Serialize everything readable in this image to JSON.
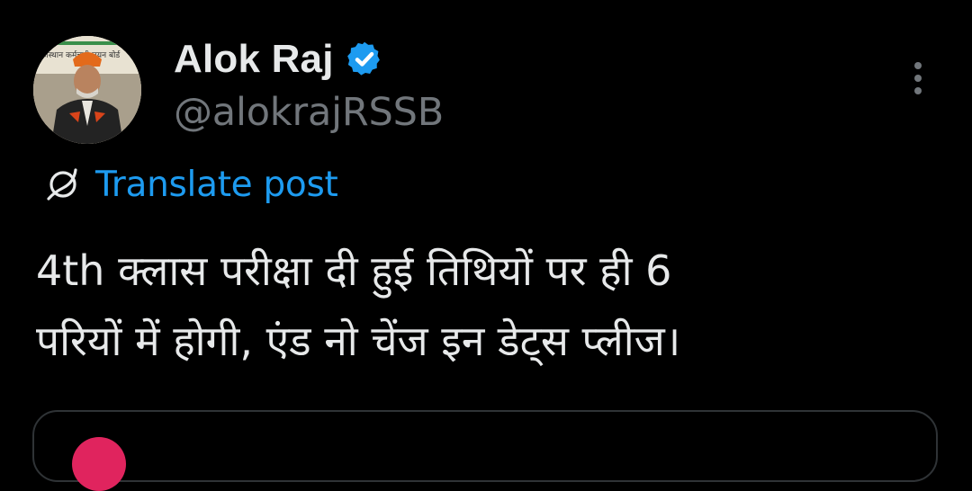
{
  "author": {
    "display_name": "Alok Raj",
    "handle": "@alokrajRSSB",
    "verified": true,
    "avatar_icon": "profile-photo",
    "avatar_sign_text": "राजस्थान कर्मचारी चयन बोर्ड"
  },
  "actions": {
    "more_icon": "three-dots-vertical-icon",
    "translate_icon": "globe-translate-icon",
    "translate_label": "Translate post"
  },
  "post": {
    "lines": [
      "4th क्लास परीक्षा दी हुई तिथियों पर ही 6",
      "परियों में होगी, एंड नो चेंज इन डेट्स प्लीज।"
    ]
  },
  "colors": {
    "background": "#000000",
    "primary_text": "#e7e9ea",
    "secondary_text": "#71767b",
    "accent": "#1d9bf0",
    "border": "#2f3336"
  }
}
